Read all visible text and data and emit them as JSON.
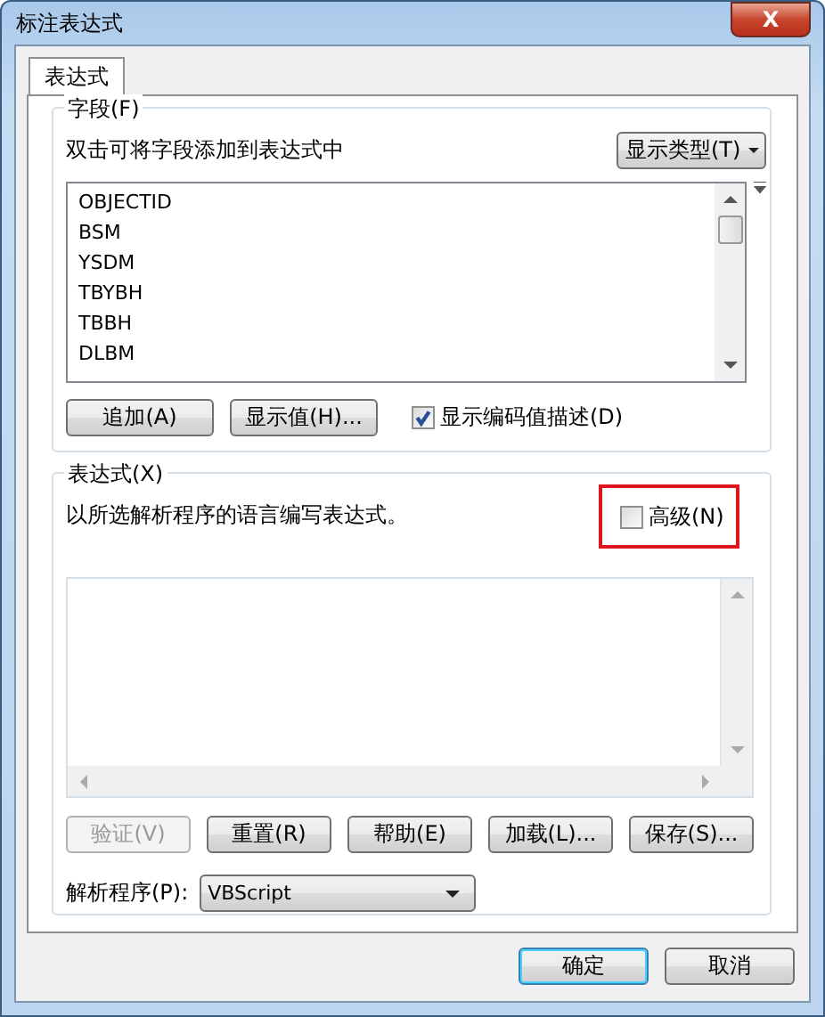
{
  "window": {
    "title": "标注表达式",
    "close_label": "X"
  },
  "tabs": [
    {
      "label": "表达式",
      "selected": true
    }
  ],
  "fields_group": {
    "title": "字段(F)",
    "hint": "双击可将字段添加到表达式中",
    "type_button": "显示类型(T)",
    "items": [
      {
        "label": "OBJECTID",
        "selected": false
      },
      {
        "label": "BSM",
        "selected": false
      },
      {
        "label": "YSDM",
        "selected": false
      },
      {
        "label": "TBYBH",
        "selected": false
      },
      {
        "label": "TBBH",
        "selected": false
      },
      {
        "label": "DLBM",
        "selected": false
      }
    ],
    "buttons": [
      "追加(A)",
      "显示值(H)..."
    ],
    "show_coded": {
      "label": "显示编码值描述(D)",
      "checked": true
    }
  },
  "expression_group": {
    "title": "表达式(X)",
    "hint": "以所选解析程序的语言编写表达式。",
    "advanced": {
      "label": "高级(N)",
      "checked": false,
      "highlighted": true
    },
    "buttons": [
      {
        "label": "验证(V)",
        "disabled": true
      },
      {
        "label": "重置(R)",
        "disabled": false
      },
      {
        "label": "帮助(E)",
        "disabled": false
      },
      {
        "label": "加载(L)...",
        "disabled": false
      },
      {
        "label": "保存(S)...",
        "disabled": false
      }
    ],
    "parser": {
      "label": "解析程序(P):",
      "value": "VBScript"
    }
  },
  "footer_buttons": [
    {
      "label": "确定",
      "default": true
    },
    {
      "label": "取消",
      "default": false
    }
  ]
}
